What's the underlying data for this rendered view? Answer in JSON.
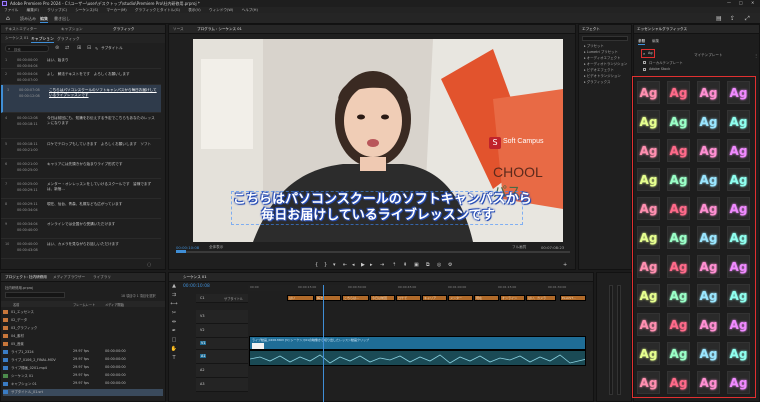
{
  "window": {
    "title": "Adobe Premiere Pro 2024 - C:\\ユーザー\\user\\デスクトップ\\studio\\Premiere Pro\\社内研修用.prproj *"
  },
  "menu": [
    "ファイル",
    "編集(E)",
    "クリップ(C)",
    "シーケンス(S)",
    "マーカー(M)",
    "グラフィックとタイトル(G)",
    "表示(V)",
    "ウィンドウ(W)",
    "ヘルプ(H)"
  ],
  "workspace_tabs": {
    "left": "読み込み",
    "mid": "編集",
    "right": "書き出し"
  },
  "left_panel": {
    "tabs": [
      "テキストエディター",
      "キャプション",
      "グラフィック"
    ],
    "active_tab": "キャプション",
    "sub_tabs": [
      "キャプション",
      "グラフィック"
    ],
    "seq_label": "シーケンス 01",
    "search_placeholder": "検索",
    "new_caption": "サブタイトル",
    "captions": [
      {
        "num": "1",
        "in": "00:00:00:00",
        "out": "00:00:04:04",
        "text": "はい、始まり"
      },
      {
        "num": "2",
        "in": "00:00:04:04",
        "out": "00:00:07:00",
        "text": "よし　解法テキストをです　よろしくお願いします"
      },
      {
        "num": "3",
        "in": "00:00:07:08",
        "out": "00:00:12:08",
        "text": "こちらはパソコンスクールのソフトキャンパスから毎日お届けしているライブレッスンです"
      },
      {
        "num": "4",
        "in": "00:00:12:08",
        "out": "00:00:18:11",
        "text": "今日は前回にも、知識をお伝えする予定でこちらもあなたのレッスンになります"
      },
      {
        "num": "5",
        "in": "00:00:18:11",
        "out": "00:00:21:00",
        "text": "ロケでテロップもしていきます　よろしくお願いします　ソフト"
      },
      {
        "num": "6",
        "in": "00:00:21:00",
        "out": "00:00:25:00",
        "text": "キャリアには先頭きから始まりライブ形式です"
      },
      {
        "num": "7",
        "in": "00:00:25:00",
        "out": "00:00:29:11",
        "text": "メンター・オンレッスンをしていけるスクールです　皆様でまずは、新宿..."
      },
      {
        "num": "8",
        "in": "00:00:29:11",
        "out": "00:00:34:04",
        "text": "現在、仙台、青森、札幌なども広がっています"
      },
      {
        "num": "9",
        "in": "00:00:34:04",
        "out": "00:00:40:00",
        "text": "オンラインでは全国から受講いただけます"
      },
      {
        "num": "10",
        "in": "00:00:40:00",
        "out": "00:00:43:08",
        "text": "はい、カメラを見ながらお話しいただけます"
      }
    ]
  },
  "program": {
    "tab": "プログラム : シーケンス 01",
    "source_tab": "ソース",
    "timecode_left": "00:00:10:08",
    "fit": "全体表示",
    "quality": "フル画質",
    "timecode_right": "00:07:08:23",
    "subtitle_line1": "こちらはパソコンスクールのソフトキャンパスから",
    "subtitle_line2": "毎日お届けしているライブレッスンです",
    "logo": "Soft Campus",
    "logo_mark": "S",
    "sign_text": "CHOOL",
    "sign_kata": "パス"
  },
  "effects_panel": {
    "tab": "エフェクト",
    "items": [
      "プリセット",
      "Lumetri プリセット",
      "オーディオエフェクト",
      "オーディオトランジション",
      "ビデオエフェクト",
      "ビデオトランジション",
      "グラフィックス"
    ]
  },
  "essential_graphics": {
    "title": "エッセンシャルグラフィックス",
    "tabs": [
      "参照",
      "編集"
    ],
    "search_label": "マイテンプレート",
    "filter_label": "Ag",
    "check1": "ローカルテンプレート",
    "check2": "Adobe Stock",
    "item_label": "Ag"
  },
  "project": {
    "tabs": [
      "プロジェクト: 社内研修用",
      "メディアブラウザー",
      "ライブラリ"
    ],
    "file": "社内研修用.prproj",
    "count": "18 項目中 1 項目を選択",
    "columns": [
      "名前",
      "フレームレート",
      "メディア開始"
    ],
    "items": [
      {
        "name": "01_エッセンス",
        "rate": "",
        "start": ""
      },
      {
        "name": "02_データ",
        "rate": "",
        "start": ""
      },
      {
        "name": "03_グラフィック",
        "rate": "",
        "start": ""
      },
      {
        "name": "04_素材",
        "rate": "",
        "start": ""
      },
      {
        "name": "05_音楽",
        "rate": "",
        "start": ""
      },
      {
        "name": "ライブ1_2324",
        "rate": "29.97 fps",
        "start": "00:00:00:00"
      },
      {
        "name": "ライブ_0106_2_FINAL.MOV",
        "rate": "29.97 fps",
        "start": "00:00:00:00"
      },
      {
        "name": "ライブ録画_0201.mp4",
        "rate": "29.97 fps",
        "start": "00:00:00:00"
      },
      {
        "name": "シーケンス 01",
        "rate": "29.97 fps",
        "start": "00:00:00:00"
      },
      {
        "name": "キャプション 01",
        "rate": "29.97 fps",
        "start": "00:00:00:00"
      },
      {
        "name": "サブタイトル_01.srt",
        "rate": "",
        "start": ""
      }
    ]
  },
  "timeline": {
    "tab": "シーケンス 01",
    "timecode": "00:00:10:08",
    "tracks": [
      "C1",
      "V3",
      "V2",
      "V1",
      "A1",
      "A2",
      "A3"
    ],
    "caption_track": "サブタイトル",
    "captions": [
      "はい",
      "解法",
      "こちらは...",
      "今日は前回",
      "ロケで",
      "キャリア",
      "メンター",
      "現在",
      "オンライン",
      "はい、カメラ",
      "ELLUST..."
    ],
    "video_clip": "ライブ動画_0206.MOV [V] シーケンス01の映像から切り出したレッスン動画クリップ",
    "ruler": [
      "00:00",
      "00:00:15:00",
      "00:00:30:00",
      "00:00:45:00",
      "00:01:00:00",
      "00:01:15:00",
      "00:01:30:00"
    ]
  },
  "colors": {
    "accent": "#3f8ed6",
    "highlight": "#e03030",
    "clip_orange": "#b06a2a",
    "clip_blue": "#1f6d96",
    "audio": "#1a4a55"
  }
}
